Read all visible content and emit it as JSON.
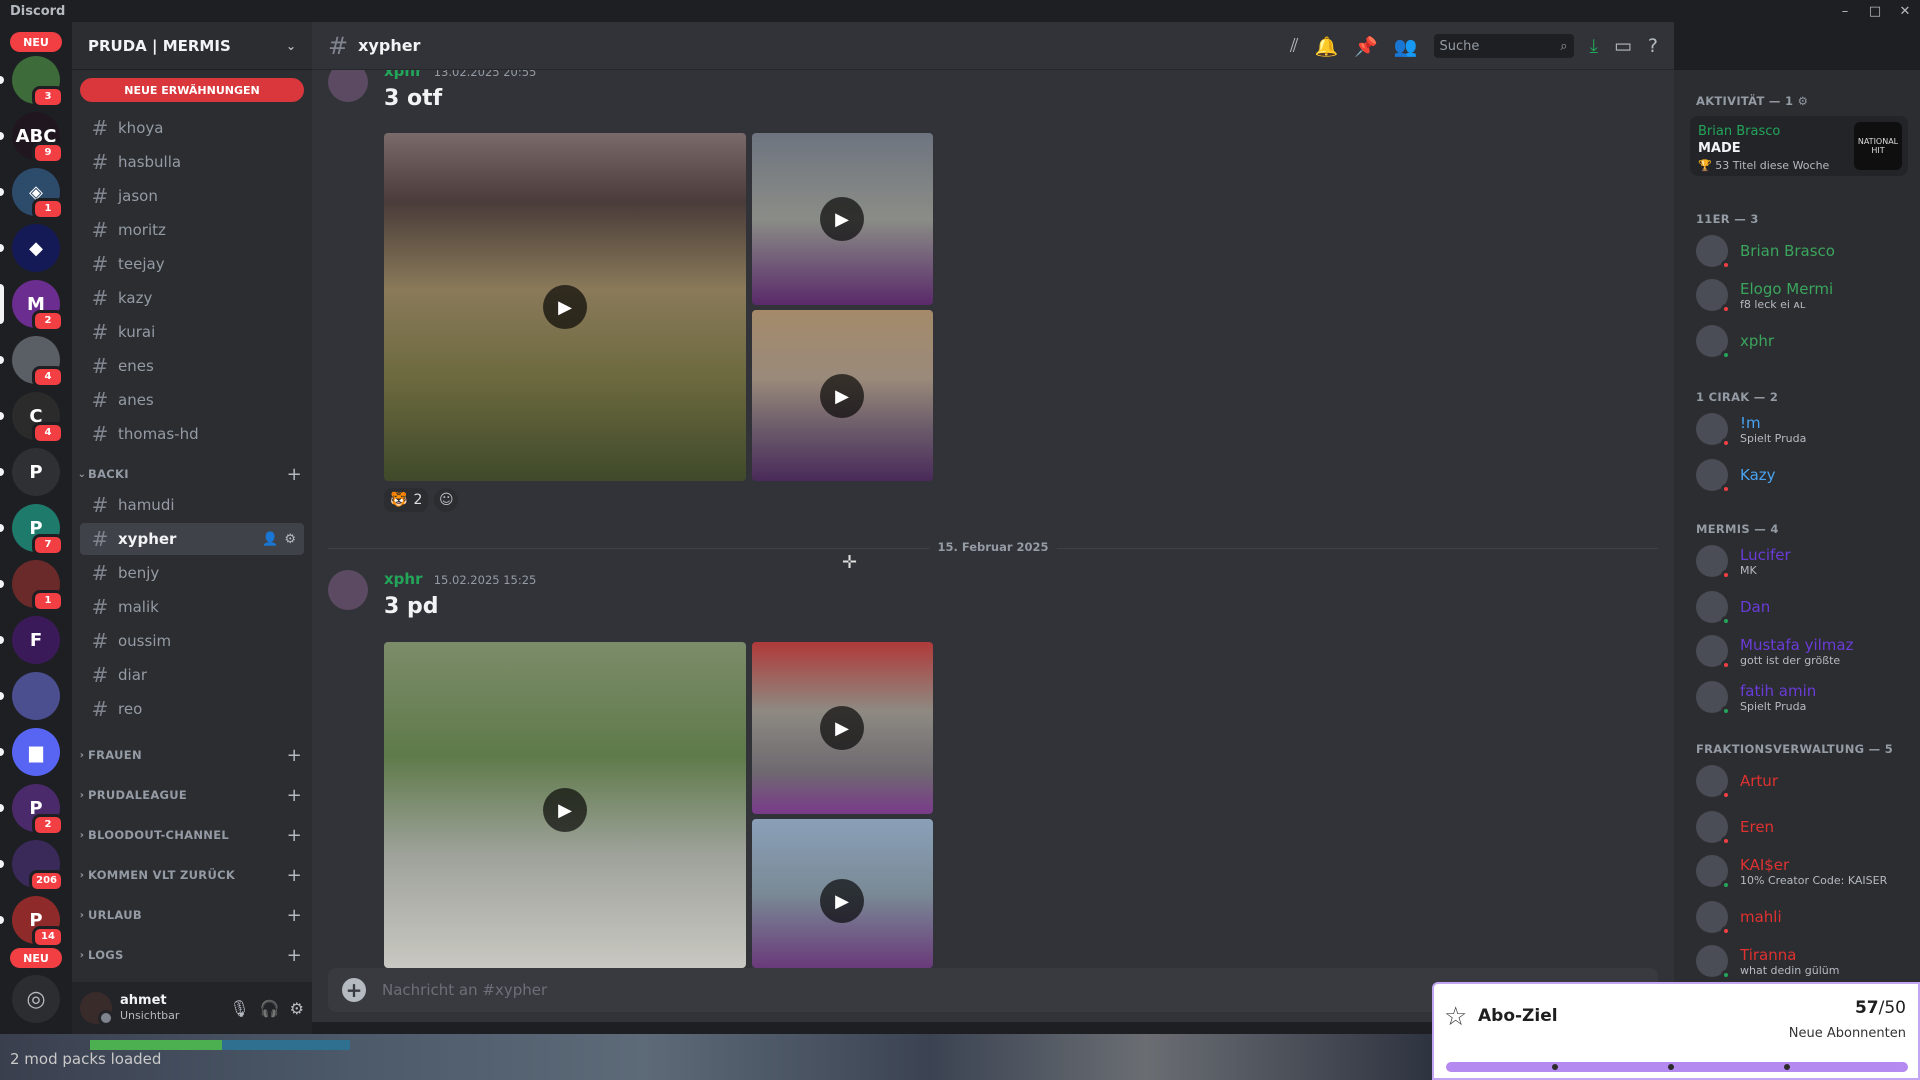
{
  "app": {
    "title": "Discord"
  },
  "rail": {
    "neu_top": "NEU",
    "neu_bottom": "NEU",
    "servers": [
      {
        "badge": "3",
        "initials": "",
        "color": "#3d6b3a"
      },
      {
        "badge": "9",
        "initials": "ABC",
        "color": "#201620"
      },
      {
        "badge": "1",
        "initials": "◈",
        "color": "#2d4b6b"
      },
      {
        "badge": "",
        "initials": "◆",
        "color": "#141a55"
      },
      {
        "badge": "2",
        "initials": "M",
        "color": "#6b2d8f"
      },
      {
        "badge": "4",
        "initials": "",
        "color": "#5a5f66"
      },
      {
        "badge": "4",
        "initials": "C",
        "color": "#2b2b2b"
      },
      {
        "badge": "",
        "initials": "P",
        "color": "#2f3034"
      },
      {
        "badge": "7",
        "initials": "P",
        "color": "#1e7a6b"
      },
      {
        "badge": "1",
        "initials": "",
        "color": "#6b2a2a"
      },
      {
        "badge": "",
        "initials": "F",
        "color": "#3b1a5a"
      },
      {
        "badge": "",
        "initials": "",
        "color": "#4b4e8f"
      },
      {
        "badge": "",
        "initials": "▆",
        "color": "#5865f2"
      },
      {
        "badge": "2",
        "initials": "P",
        "color": "#4a2a6a"
      },
      {
        "badge": "206",
        "initials": "",
        "color": "#3a2a5a"
      },
      {
        "badge": "14",
        "initials": "P",
        "color": "#8f2a2a"
      }
    ]
  },
  "guild": {
    "name": "PRUDA | MERMIS",
    "mentions_label": "NEUE ERWÄHNUNGEN",
    "channels_top": [
      "khoya",
      "hasbulla",
      "jason",
      "moritz",
      "teejay",
      "kazy",
      "kurai",
      "enes",
      "anes",
      "thomas-hd"
    ],
    "category_backi": "BACKI",
    "channels_backi": [
      "hamudi",
      "xypher",
      "benjy",
      "malik",
      "oussim",
      "diar",
      "reo"
    ],
    "collapsed_categories": [
      "FRAUEN",
      "PRUDALEAGUE",
      "BLOODOUT-CHANNEL",
      "KOMMEN VLT ZURÜCK",
      "URLAUB",
      "LOGS"
    ]
  },
  "user": {
    "name": "ahmet",
    "status": "Unsichtbar"
  },
  "chat": {
    "channel": "xypher",
    "search_placeholder": "Suche",
    "messages": [
      {
        "author": "xphr",
        "time": "13.02.2025 20:55",
        "text": "3 otf",
        "reaction_count": "2"
      },
      {
        "author": "xphr",
        "time": "15.02.2025 15:25",
        "text": "3 pd"
      }
    ],
    "date_divider": "15. Februar 2025",
    "composer_placeholder": "Nachricht an #xypher"
  },
  "members": {
    "activity_header": "AKTIVITÄT — 1",
    "activity": {
      "name": "Brian Brasco",
      "title": "MADE",
      "sub": "53 Titel diese Woche",
      "art": "NATIONAL HIT"
    },
    "groups": [
      {
        "header": "11ER — 3",
        "items": [
          {
            "name": "Brian Brasco",
            "sub": "",
            "color": "#3ba55d",
            "status": "#f23f43"
          },
          {
            "name": "Elogo Mermi",
            "sub": "f8 leck ei ᴀʟ",
            "color": "#3ba55d",
            "status": "#f23f43"
          },
          {
            "name": "xphr",
            "sub": "",
            "color": "#3ba55d",
            "status": "#23a55a"
          }
        ]
      },
      {
        "header": "1 CIRAK — 2",
        "items": [
          {
            "name": "!m",
            "sub": "Spielt Pruda",
            "color": "#4aa3f0",
            "status": "#f23f43"
          },
          {
            "name": "Kazy",
            "sub": "",
            "color": "#4aa3f0",
            "status": "#f23f43"
          }
        ]
      },
      {
        "header": "MERMIS — 4",
        "items": [
          {
            "name": "Lucifer",
            "sub": "MK",
            "color": "#6a3bd6",
            "status": "#f23f43"
          },
          {
            "name": "Dan",
            "sub": "",
            "color": "#6a3bd6",
            "status": "#23a55a"
          },
          {
            "name": "Mustafa yilmaz",
            "sub": "gott ist der größte",
            "color": "#6a3bd6",
            "status": "#f23f43"
          },
          {
            "name": "fatih amin",
            "sub": "Spielt Pruda",
            "color": "#6a3bd6",
            "status": "#23a55a"
          }
        ]
      },
      {
        "header": "FRAKTIONSVERWALTUNG — 5",
        "items": [
          {
            "name": "Artur",
            "sub": "",
            "color": "#e03131",
            "status": "#f23f43"
          },
          {
            "name": "Eren",
            "sub": "",
            "color": "#e03131",
            "status": "#f23f43"
          },
          {
            "name": "KAI$er",
            "sub": "10% Creator Code: KAISER",
            "color": "#e03131",
            "status": "#23a55a"
          },
          {
            "name": "mahli",
            "sub": "",
            "color": "#e03131",
            "status": "#f23f43"
          },
          {
            "name": "Tiranna",
            "sub": "what dedin gülüm",
            "color": "#e03131",
            "status": "#23a55a"
          }
        ]
      }
    ]
  },
  "overlay": {
    "title": "Abo-Ziel",
    "current": "57",
    "goal": "/50",
    "label": "Neue Abonnenten",
    "progress": 1.0
  },
  "game": {
    "mod_text": "2 mod packs loaded"
  }
}
